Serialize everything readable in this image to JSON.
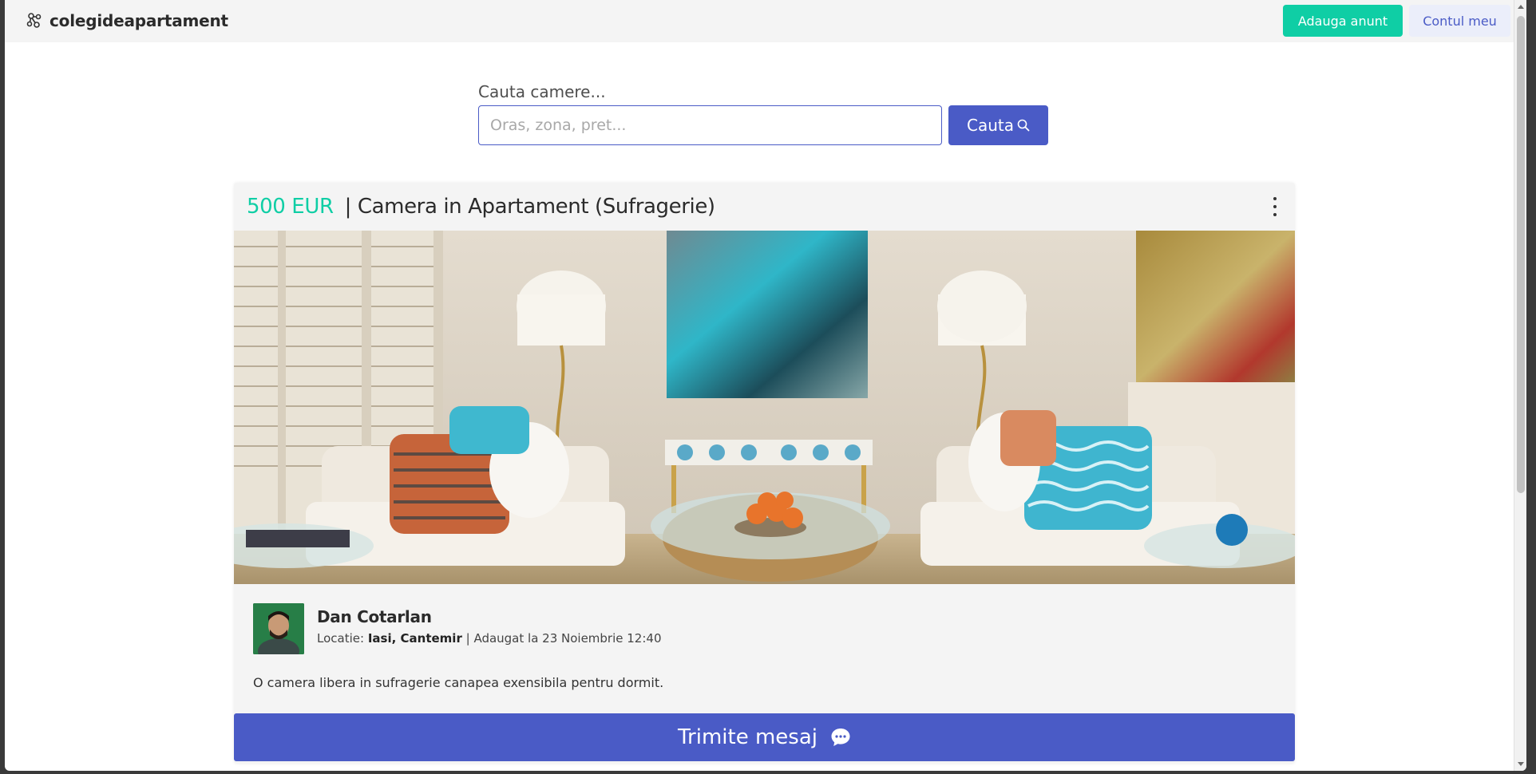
{
  "navbar": {
    "brand": "colegideapartament",
    "add_button": "Adauga anunt",
    "account_button": "Contul meu"
  },
  "search": {
    "label": "Cauta camere...",
    "placeholder": "Oras, zona, pret...",
    "value": "",
    "button": "Cauta"
  },
  "listing": {
    "price": "500 EUR",
    "title": "| Camera in Apartament (Sufragerie)",
    "author_name": "Dan Cotarlan",
    "location_label": "Locatie:",
    "location": "Iasi, Cantemir",
    "added": "| Adaugat la 23 Noiembrie 12:40",
    "description": "O camera libera in sufragerie canapea exensibila pentru dormit.",
    "message_button": "Trimite mesaj"
  },
  "colors": {
    "accent_green": "#0fcea5",
    "accent_blue": "#4a5bc6",
    "navbar_bg": "#f4f4f4"
  },
  "icons": [
    "logo-molecule-icon",
    "search-icon",
    "more-vertical-icon",
    "chat-bubble-icon"
  ]
}
